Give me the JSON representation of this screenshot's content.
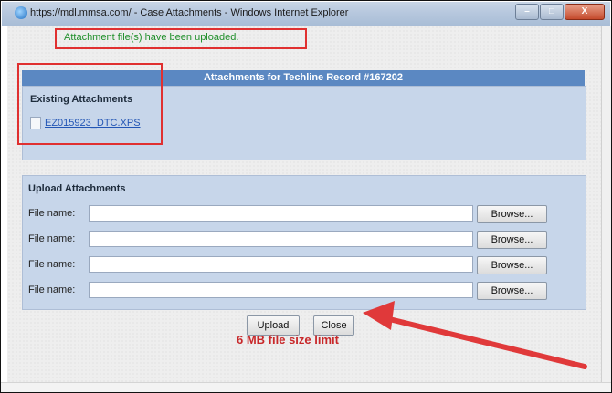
{
  "window": {
    "title": "https://mdl.mmsa.com/ - Case Attachments - Windows Internet Explorer",
    "controls": {
      "minimize": "–",
      "maximize": "□",
      "close": "X"
    }
  },
  "message": "Attachment file(s) have been uploaded.",
  "header": "Attachments for Techline Record #167202",
  "existing": {
    "title": "Existing Attachments",
    "files": [
      "EZ015923_DTC.XPS"
    ]
  },
  "upload": {
    "title": "Upload Attachments",
    "rows": [
      {
        "label": "File name:",
        "browse": "Browse..."
      },
      {
        "label": "File name:",
        "browse": "Browse..."
      },
      {
        "label": "File name:",
        "browse": "Browse..."
      },
      {
        "label": "File name:",
        "browse": "Browse..."
      }
    ]
  },
  "buttons": {
    "upload": "Upload",
    "close": "Close"
  },
  "annotation": "6 MB file size limit",
  "colors": {
    "header_bar": "#5b88c2",
    "panel": "#c7d6ea",
    "annotation": "#e03030",
    "success_text": "#1f8f2a"
  }
}
